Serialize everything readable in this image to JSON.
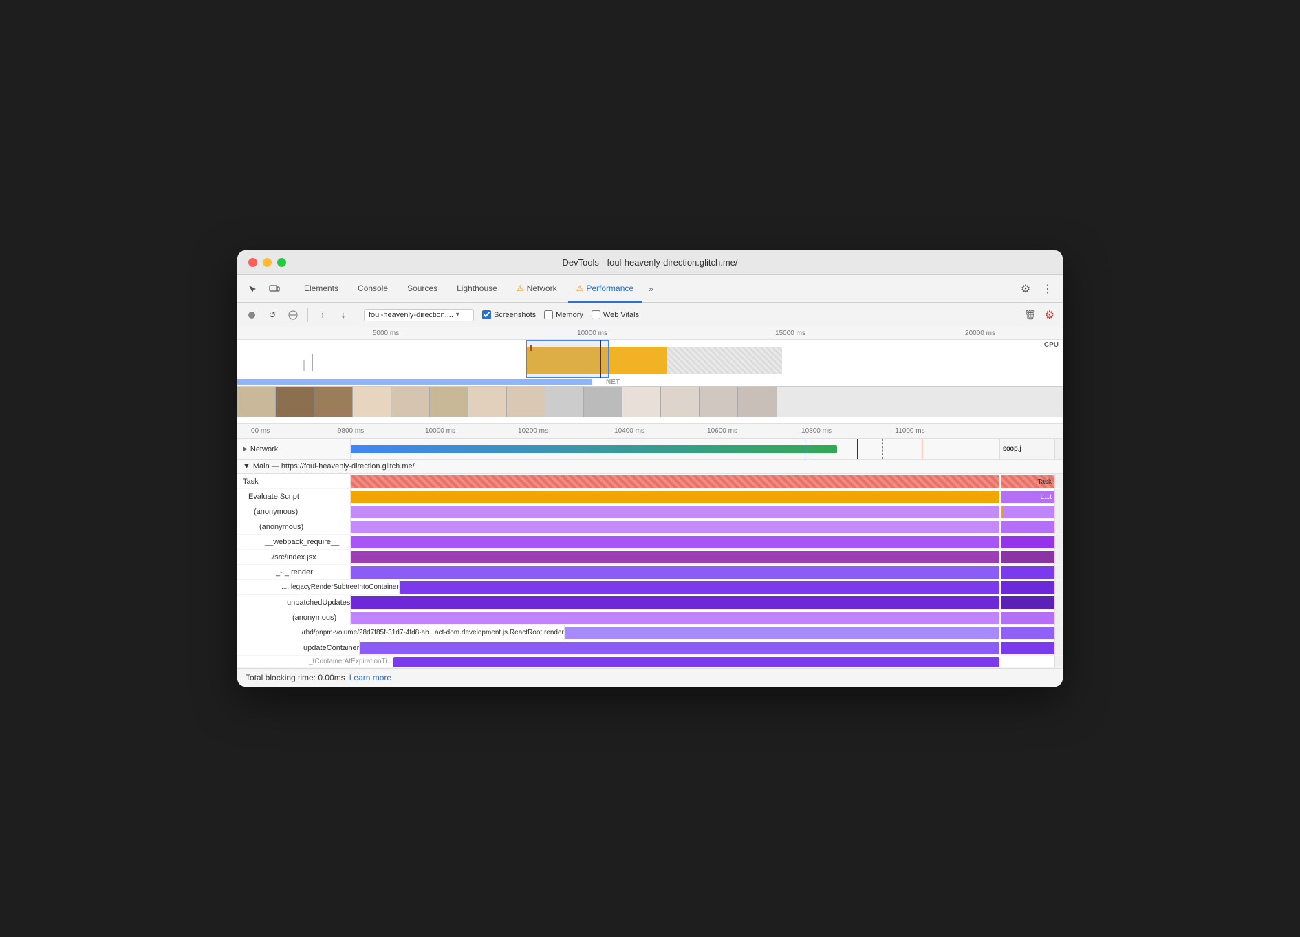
{
  "window": {
    "title": "DevTools - foul-heavenly-direction.glitch.me/"
  },
  "nav": {
    "tabs": [
      {
        "id": "elements",
        "label": "Elements",
        "active": false
      },
      {
        "id": "console",
        "label": "Console",
        "active": false
      },
      {
        "id": "sources",
        "label": "Sources",
        "active": false
      },
      {
        "id": "lighthouse",
        "label": "Lighthouse",
        "active": false
      },
      {
        "id": "network",
        "label": "Network",
        "active": false,
        "warn": true
      },
      {
        "id": "performance",
        "label": "Performance",
        "active": true,
        "warn": true
      }
    ],
    "more_label": "»",
    "gear_icon": "⚙",
    "dots_icon": "⋮"
  },
  "toolbar": {
    "record_label": "●",
    "reload_label": "↺",
    "clear_label": "⊘",
    "upload_label": "↑",
    "download_label": "↓",
    "url_text": "foul-heavenly-direction....",
    "screenshots_label": "Screenshots",
    "memory_label": "Memory",
    "web_vitals_label": "Web Vitals",
    "trash_icon": "🗑",
    "settings_icon": "⚙"
  },
  "time_ruler": {
    "marks": [
      "5000 ms",
      "10000 ms",
      "15000 ms",
      "20000 ms"
    ],
    "cpu_label": "CPU",
    "net_label": "NET"
  },
  "zoomed_ruler": {
    "marks": [
      "00 ms",
      "9800 ms",
      "10000 ms",
      "10200 ms",
      "10400 ms",
      "10600 ms",
      "10800 ms",
      "11000 ms"
    ]
  },
  "network_track": {
    "label": "Network",
    "soop_label": "soop.j"
  },
  "main_track": {
    "header": "Main — https://foul-heavenly-direction.glitch.me/"
  },
  "flame_rows": [
    {
      "label": "Task",
      "bar_label": "Task",
      "indent": 0,
      "color": "task-red",
      "bar_label_right": "Task"
    },
    {
      "label": "Evaluate Script",
      "bar_label": "L...t",
      "indent": 1,
      "color": "evaluate-gold"
    },
    {
      "label": "(anonymous)",
      "bar_label": "",
      "indent": 2,
      "color": "anon-purple"
    },
    {
      "label": "(anonymous)",
      "bar_label": "",
      "indent": 3,
      "color": "anon-purple2"
    },
    {
      "label": "__webpack_require__",
      "bar_label": "",
      "indent": 4,
      "color": "webpack-purple"
    },
    {
      "label": "./src/index.jsx",
      "bar_label": "",
      "indent": 5,
      "color": "index-purple"
    },
    {
      "label": "_-._  render",
      "bar_label": "",
      "indent": 6,
      "color": "render-purple"
    },
    {
      "label": "....  legacyRenderSubtreeIntoContainer",
      "bar_label": "",
      "indent": 7,
      "color": "legacy-purple"
    },
    {
      "label": "unbatchedUpdates",
      "bar_label": "",
      "indent": 8,
      "color": "unbatched-purple"
    },
    {
      "label": "(anonymous)",
      "bar_label": "",
      "indent": 9,
      "color": "anon3-purple"
    },
    {
      "label": "../rbd/pnpm-volume/28d7f85f-31d7-4fd8-ab...act-dom.development.js.ReactRoot.render",
      "bar_label": "",
      "indent": 10,
      "color": "rbd-purple"
    },
    {
      "label": "updateContainer",
      "bar_label": "",
      "indent": 11,
      "color": "update-purple"
    }
  ],
  "status_bar": {
    "text": "Total blocking time: 0.00ms",
    "learn_more": "Learn more"
  },
  "colors": {
    "accent_blue": "#1a73e8",
    "warn_orange": "#f59300",
    "active_tab_border": "#1a73e8"
  }
}
